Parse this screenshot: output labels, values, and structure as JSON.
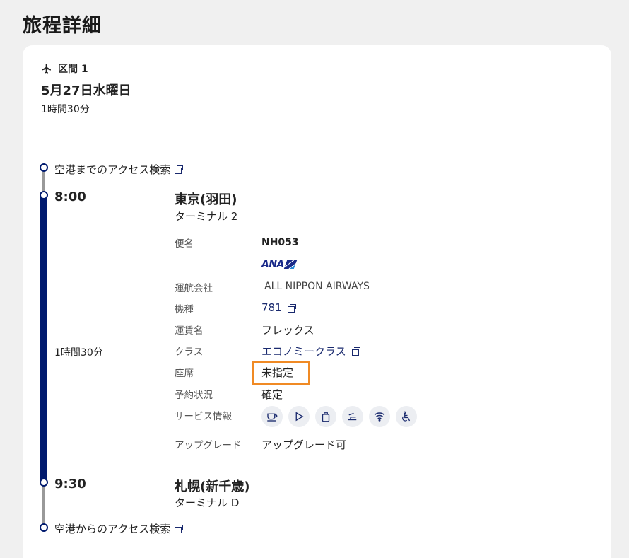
{
  "page": {
    "title": "旅程詳細"
  },
  "segment": {
    "label": "区間 1",
    "date": "5月27日水曜日",
    "duration": "1時間30分"
  },
  "access": {
    "to_airport": "空港までのアクセス検索",
    "from_airport": "空港からのアクセス検索"
  },
  "departure": {
    "time": "8:00",
    "airport": "東京(羽田)",
    "terminal": "ターミナル 2"
  },
  "arrival": {
    "time": "9:30",
    "airport": "札幌(新千歳)",
    "terminal": "ターミナル D"
  },
  "flight_duration": "1時間30分",
  "details": {
    "flight_no_label": "便名",
    "flight_no": "NH053",
    "airline_logo_text": "ANA",
    "carrier_label": "運航会社",
    "carrier": "ALL NIPPON AIRWAYS",
    "aircraft_label": "機種",
    "aircraft": "781",
    "fare_label": "運賃名",
    "fare": "フレックス",
    "class_label": "クラス",
    "class": "エコノミークラス",
    "seat_label": "座席",
    "seat": "未指定",
    "status_label": "予約状況",
    "status": "確定",
    "service_label": "サービス情報",
    "services": [
      "cup-icon",
      "play-icon",
      "bag-icon",
      "seat-recline-icon",
      "wifi-icon",
      "accessibility-icon"
    ],
    "upgrade_label": "アップグレード",
    "upgrade": "アップグレード可"
  },
  "colors": {
    "navy": "#001a6e",
    "highlight": "#f08a24"
  }
}
